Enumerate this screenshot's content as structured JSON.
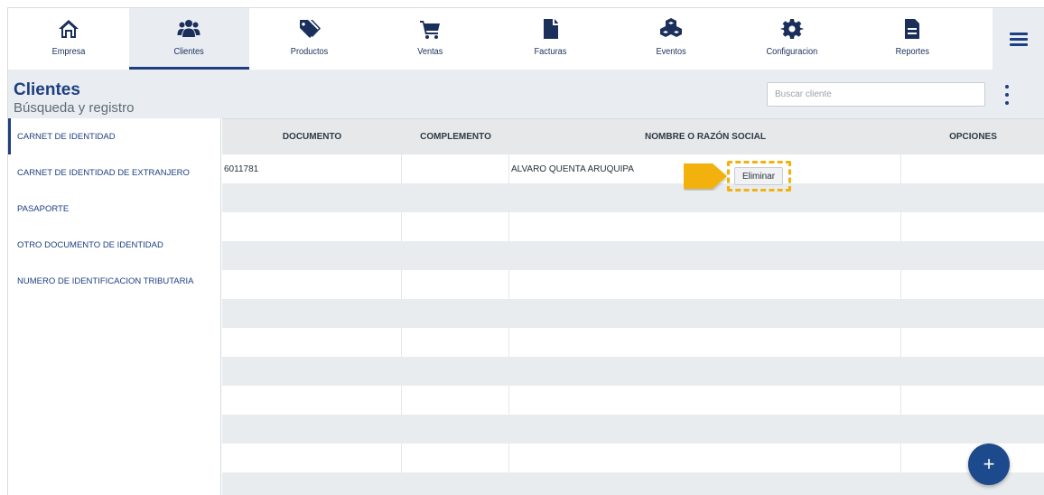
{
  "nav": {
    "items": [
      {
        "label": "Empresa",
        "icon": "home-icon"
      },
      {
        "label": "Clientes",
        "icon": "users-icon"
      },
      {
        "label": "Productos",
        "icon": "tags-icon"
      },
      {
        "label": "Ventas",
        "icon": "cart-icon"
      },
      {
        "label": "Facturas",
        "icon": "file-icon"
      },
      {
        "label": "Eventos",
        "icon": "cubes-icon"
      },
      {
        "label": "Configuracion",
        "icon": "gear-icon"
      },
      {
        "label": "Reportes",
        "icon": "report-icon"
      }
    ],
    "active": "Clientes"
  },
  "header": {
    "title": "Clientes",
    "subtitle": "Búsqueda y registro",
    "search_placeholder": "Buscar cliente"
  },
  "sidebar": {
    "items": [
      {
        "label": "CARNET DE IDENTIDAD"
      },
      {
        "label": "CARNET DE IDENTIDAD DE EXTRANJERO"
      },
      {
        "label": "PASAPORTE"
      },
      {
        "label": "OTRO DOCUMENTO DE IDENTIDAD"
      },
      {
        "label": "NUMERO DE IDENTIFICACION TRIBUTARIA"
      }
    ]
  },
  "table": {
    "columns": [
      "DOCUMENTO",
      "COMPLEMENTO",
      "NOMBRE O RAZÓN SOCIAL",
      "OPCIONES"
    ],
    "rows": [
      {
        "documento": "6011781",
        "complemento": "",
        "nombre": "ALVARO QUENTA ARUQUIPA",
        "opcion": "Eliminar"
      }
    ]
  },
  "fab": {
    "label": "+"
  },
  "colors": {
    "primary": "#1d3f80",
    "highlight": "#f2b10e",
    "header_bg": "#e9edf2"
  }
}
